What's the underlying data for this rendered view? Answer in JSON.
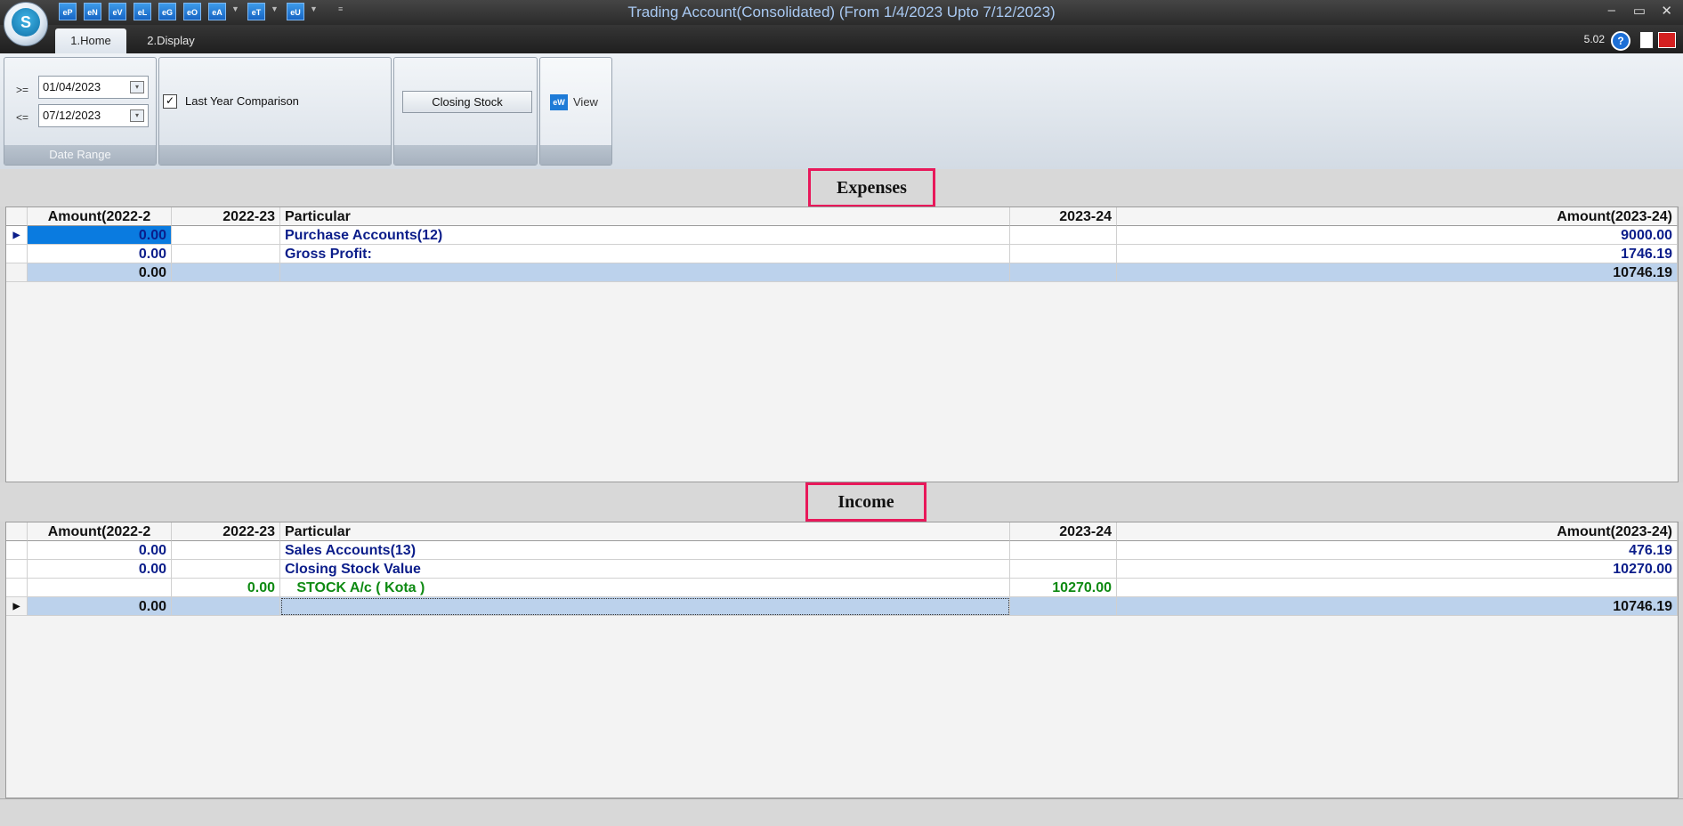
{
  "title_bar": {
    "title": "Trading Account(Consolidated) (From 1/4/2023 Upto 7/12/2023)",
    "logo_letter": "S",
    "quick_access": [
      "eP",
      "eN",
      "eV",
      "eL",
      "eG",
      "eO",
      "eA",
      "eT",
      "eU"
    ]
  },
  "tabs": [
    {
      "label": "1.Home",
      "active": true
    },
    {
      "label": "2.Display",
      "active": false
    }
  ],
  "version": "5.02",
  "ribbon": {
    "date_range": {
      "from_op": ">=",
      "from_value": "01/04/2023",
      "to_op": "<=",
      "to_value": "07/12/2023",
      "caption": "Date Range"
    },
    "last_year_comparison": {
      "label": "Last Year Comparison",
      "checked": true
    },
    "closing_stock_label": "Closing Stock",
    "view_label": "View",
    "view_icon_text": "eW"
  },
  "columns": {
    "amount_prev": "Amount(2022-2",
    "prev_year": "2022-23",
    "particular": "Particular",
    "cur_year": "2023-24",
    "amount_cur": "Amount(2023-24)"
  },
  "expenses": {
    "title": "Expenses",
    "rows": [
      {
        "amount_prev": "0.00",
        "prev_year": "",
        "particular": "Purchase Accounts(12)",
        "cur_year": "",
        "amount_cur": "9000.00",
        "selected": true
      },
      {
        "amount_prev": "0.00",
        "prev_year": "",
        "particular": "Gross Profit:",
        "cur_year": "",
        "amount_cur": "1746.19"
      }
    ],
    "total": {
      "amount_prev": "0.00",
      "amount_cur": "10746.19"
    }
  },
  "income": {
    "title": "Income",
    "rows": [
      {
        "amount_prev": "0.00",
        "prev_year": "",
        "particular": "Sales Accounts(13)",
        "cur_year": "",
        "amount_cur": "476.19"
      },
      {
        "amount_prev": "0.00",
        "prev_year": "",
        "particular": "Closing Stock Value",
        "cur_year": "",
        "amount_cur": "10270.00"
      },
      {
        "amount_prev": "",
        "prev_year": "0.00",
        "particular": "   STOCK A/c ( Kota )",
        "cur_year": "10270.00",
        "amount_cur": "",
        "green": true
      }
    ],
    "total": {
      "amount_prev": "0.00",
      "amount_cur": "10746.19"
    }
  },
  "colors": {
    "account_text": "#0b1d8a",
    "sub_ledger_text": "#0e8a12",
    "total_row_bg": "#bcd2ec",
    "section_title_border": "#e8185a",
    "selected_cell_bg": "#0a7be0"
  }
}
